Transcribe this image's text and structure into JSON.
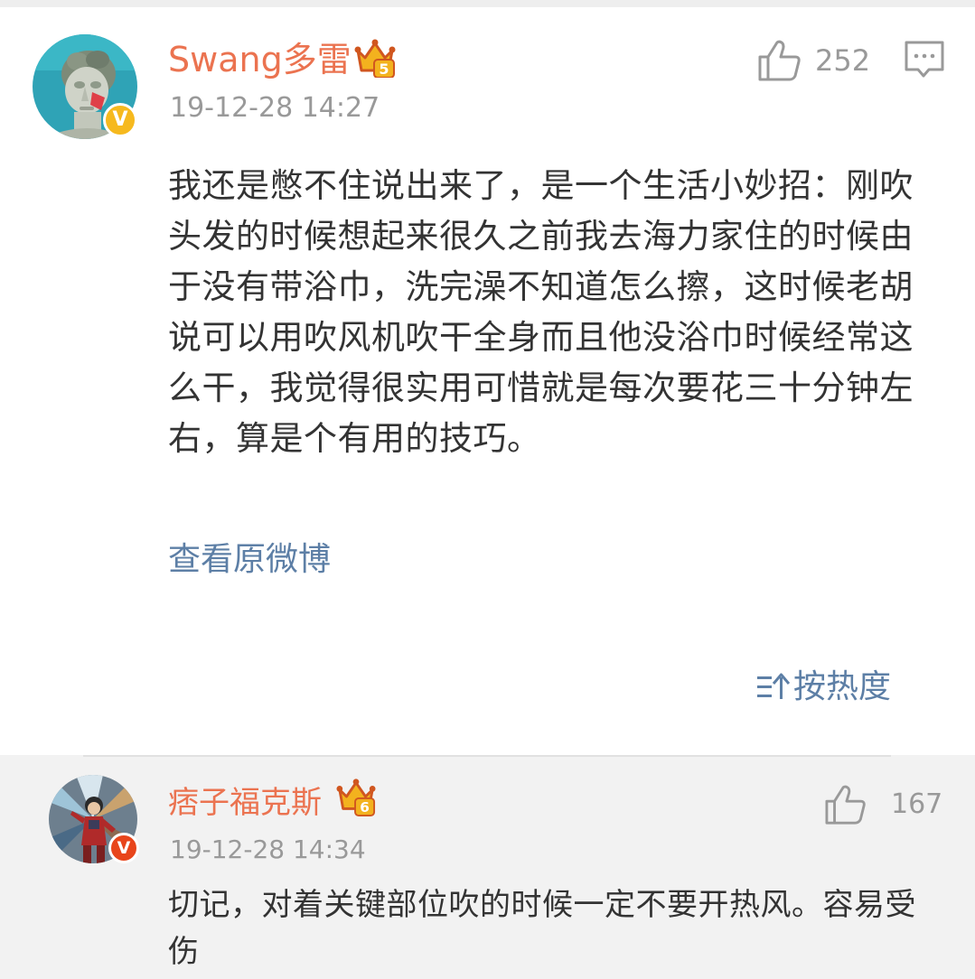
{
  "main_comment": {
    "username": "Swang多雷",
    "verified_mark": "V",
    "member_level": "5",
    "timestamp": "19-12-28 14:27",
    "like_count": "252",
    "body": "我还是憋不住说出来了，是一个生活小妙招：刚吹头发的时候想起来很久之前我去海力家住的时候由于没有带浴巾，洗完澡不知道怎么擦，这时候老胡说可以用吹风机吹干全身而且他没浴巾时候经常这么干，我觉得很实用可惜就是每次要花三十分钟左右，算是个有用的技巧。",
    "view_original_label": "查看原微博"
  },
  "sort": {
    "label": "按热度"
  },
  "reply": {
    "username": "痞子福克斯",
    "verified_mark": "V",
    "member_level": "6",
    "timestamp": "19-12-28 14:34",
    "like_count": "167",
    "body": "切记，对着关键部位吹的时候一定不要开热风。容易受伤"
  },
  "colors": {
    "username": "#eb7350",
    "link": "#5d7fa6",
    "meta": "#999999",
    "body_text": "#333333",
    "verified_badge": "#f6b91e",
    "reply_background": "#f2f2f2"
  },
  "icons": {
    "like": "thumbs-up-icon",
    "comment": "comment-bubble-icon",
    "crown": "vip-crown-icon",
    "sort": "sort-icon"
  }
}
